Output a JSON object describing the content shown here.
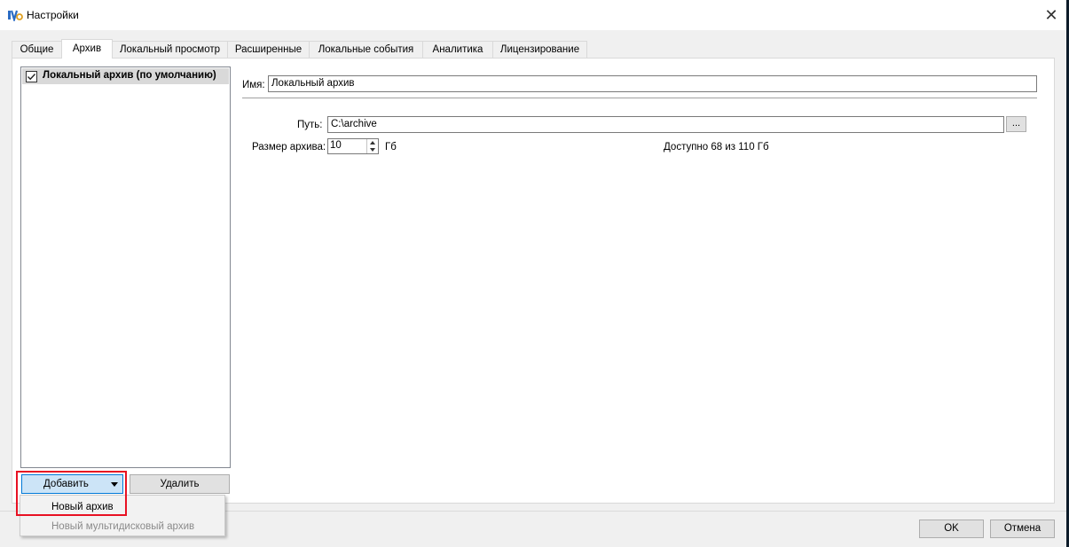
{
  "window": {
    "title": "Настройки",
    "close_glyph": "✕",
    "icon": "app-logo-icon"
  },
  "tabs": [
    {
      "label": "Общие"
    },
    {
      "label": "Архив"
    },
    {
      "label": "Локальный просмотр"
    },
    {
      "label": "Расширенные"
    },
    {
      "label": "Локальные события"
    },
    {
      "label": "Аналитика"
    },
    {
      "label": "Лицензирование"
    }
  ],
  "active_tab": "Архив",
  "archive_list": {
    "items": [
      {
        "label": "Локальный архив (по умолчанию)",
        "checked": true
      }
    ]
  },
  "buttons": {
    "add": "Добавить",
    "delete": "Удалить",
    "ok": "OK",
    "cancel": "Отмена"
  },
  "add_menu": {
    "items": [
      {
        "label": "Новый архив",
        "enabled": true
      },
      {
        "label": "Новый мультидисковый архив",
        "enabled": false
      }
    ]
  },
  "details": {
    "name_label": "Имя:",
    "name_value": "Локальный архив",
    "path_label": "Путь:",
    "path_value": "C:\\archive",
    "browse_label": "...",
    "size_label": "Размер архива:",
    "size_value": "10",
    "size_unit": "Гб",
    "available": "Доступно 68 из 110 Гб"
  },
  "colors": {
    "highlight": "#e81123",
    "selection": "#cce4f7"
  }
}
